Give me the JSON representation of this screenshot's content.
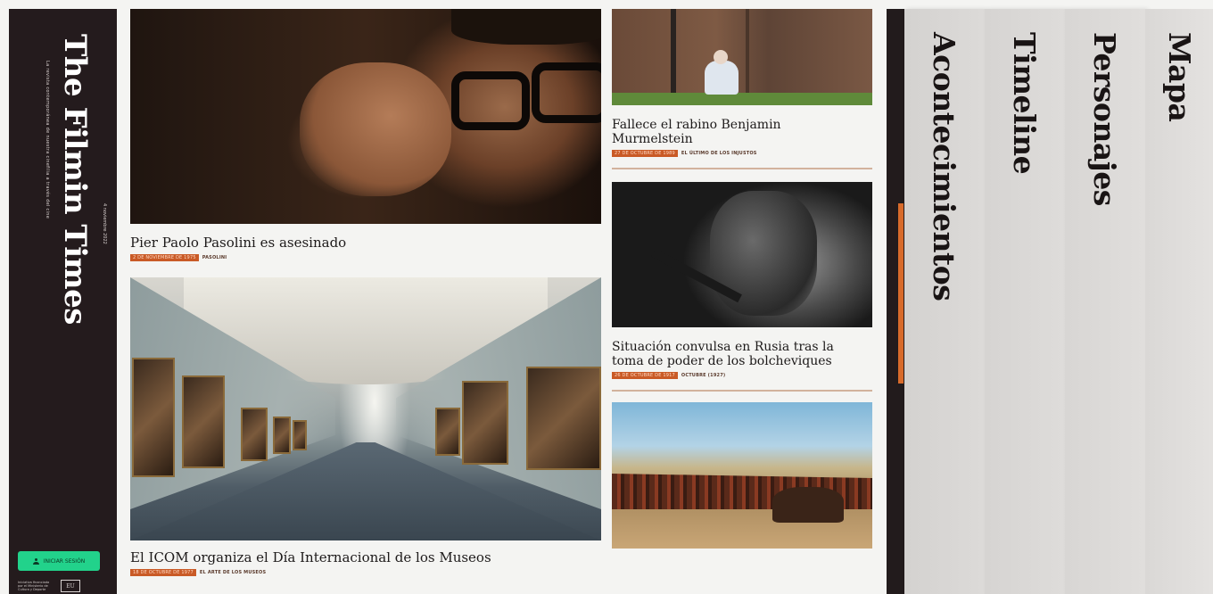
{
  "brand": {
    "title": "The Filmin Times",
    "tagline": "La revista contemporánea de nuestra cinefilia a través del cine",
    "date": "4 noviembre 2022"
  },
  "auth": {
    "login_label": "INICIAR SESIÓN"
  },
  "sponsor": {
    "text": "Iniciativa financiada por el Ministerio de Cultura y Deporte",
    "logo": "EU"
  },
  "articles": [
    {
      "headline": "Pier Paolo Pasolini es asesinado",
      "date": "2 de noviembre de 1975",
      "category": "Pasolini"
    },
    {
      "headline": "El ICOM organiza el Día Internacional de los Museos",
      "date": "18 de octubre de 1977",
      "category": "El arte de los museos"
    },
    {
      "headline": "Fallece el rabino Benjamin Murmelstein",
      "date": "27 de octubre de 1989",
      "category": "El último de los injustos"
    },
    {
      "headline": "Situación convulsa en Rusia tras la toma de poder de los bolcheviques",
      "date": "26 de octubre de 1917",
      "category": "Octubre (1927)"
    }
  ],
  "nav": {
    "tabs": [
      {
        "label": "Acontecimientos"
      },
      {
        "label": "Timeline"
      },
      {
        "label": "Personajes"
      },
      {
        "label": "Mapa"
      }
    ]
  },
  "colors": {
    "accent": "#c95a26",
    "sidebar": "#241b1d",
    "login": "#22d28b",
    "scroll_thumb": "#d86b2b"
  }
}
